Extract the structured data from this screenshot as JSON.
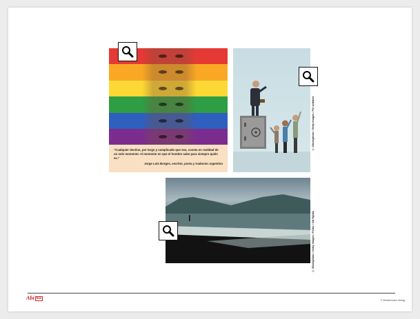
{
  "quote": {
    "text": "“Cualquier destino, por largo y complicado que sea, consta en realidad de un solo momento: el momento en que el hombre sabe para siempre quién es.”",
    "author": "Jorge Luis Borges, escritor, poeta y traductor argentino"
  },
  "credits": {
    "illustration": "© iStockphoto / Getty Images / Pol solfabet",
    "beach": "© iStockphoto / Getty Images / Pedro / Gtt Rghas"
  },
  "zoom_buttons": [
    {
      "label": "zoom-rainbow",
      "icon": "magnifier-icon"
    },
    {
      "label": "zoom-illustration",
      "icon": "magnifier-icon"
    },
    {
      "label": "zoom-beach",
      "icon": "magnifier-icon"
    }
  ],
  "footer": {
    "logo_text": "Abi",
    "logo_box": "box",
    "copyright": "© Westermann Verlag"
  },
  "colors": {
    "rainbow": [
      "#e53935",
      "#f9a825",
      "#fdd835",
      "#2e9e44",
      "#2f5fbf",
      "#7b2d8f"
    ],
    "brand": "#c62828",
    "quote_bg": "#fae0c2"
  }
}
